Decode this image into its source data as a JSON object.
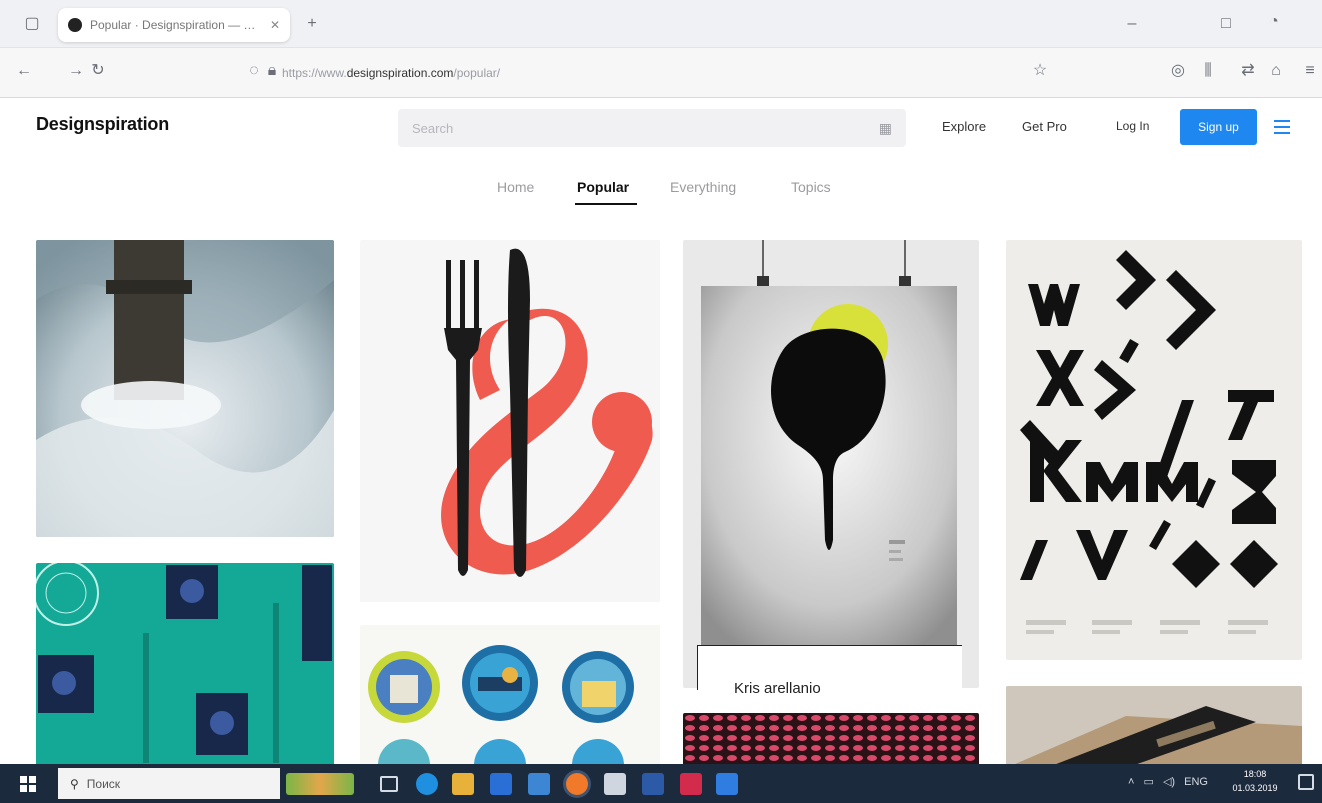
{
  "browser": {
    "tab_title": "Popular · Designspiration — …",
    "url_prefix": "https://www.",
    "url_domain": "designspiration.com",
    "url_path": "/popular/"
  },
  "site": {
    "logo": "Designspiration",
    "search_placeholder": "Search",
    "nav": {
      "explore": "Explore",
      "get_pro": "Get Pro",
      "login": "Log In",
      "signup": "Sign up"
    },
    "tabs": [
      "Home",
      "Popular",
      "Everything",
      "Topics"
    ],
    "active_tab": "Popular"
  },
  "grid": {
    "hover_caption": "Kris arellanio"
  },
  "taskbar": {
    "search_placeholder": "Поиск",
    "tray_lang": "ENG",
    "time": "18:08",
    "date": "01.03.2019"
  },
  "colors": {
    "accent": "#1e88f0",
    "coral": "#ef5b4f",
    "teal": "#14a996",
    "taskbar": "#1c2a3e"
  }
}
